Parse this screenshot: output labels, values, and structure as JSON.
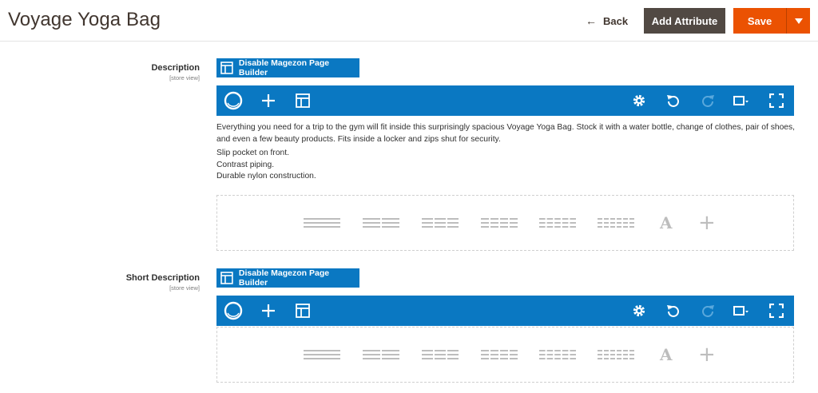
{
  "header": {
    "title": "Voyage Yoga Bag",
    "back_label": "Back",
    "add_attribute_label": "Add Attribute",
    "save_label": "Save"
  },
  "colors": {
    "accent_blue": "#0a78c2",
    "save_orange": "#eb5202",
    "dark_button": "#514943"
  },
  "fields": [
    {
      "label": "Description",
      "scope": "[store view]",
      "disable_builder_label": "Disable Magezon Page Builder",
      "content": {
        "intro": "Everything you need for a trip to the gym will fit inside this surprisingly spacious Voyage Yoga Bag. Stock it with a water bottle, change of clothes, pair of shoes, and even a few beauty products. Fits inside a locker and zips shut for security.",
        "features": [
          "Slip pocket on front.",
          "Contrast piping.",
          "Durable nylon construction."
        ]
      }
    },
    {
      "label": "Short Description",
      "scope": "[store view]",
      "disable_builder_label": "Disable Magezon Page Builder"
    }
  ],
  "toolbar_icons": [
    "builder-logo-icon",
    "add-element-icon",
    "templates-icon",
    "settings-icon",
    "undo-icon",
    "redo-icon",
    "responsive-icon",
    "fullscreen-icon"
  ],
  "layout_options": [
    "1-column",
    "2-columns",
    "3-columns",
    "4-columns",
    "5-columns",
    "6-columns",
    "text-element",
    "add-element"
  ],
  "layout_text_glyph": "A",
  "layout_add_glyph": "+"
}
